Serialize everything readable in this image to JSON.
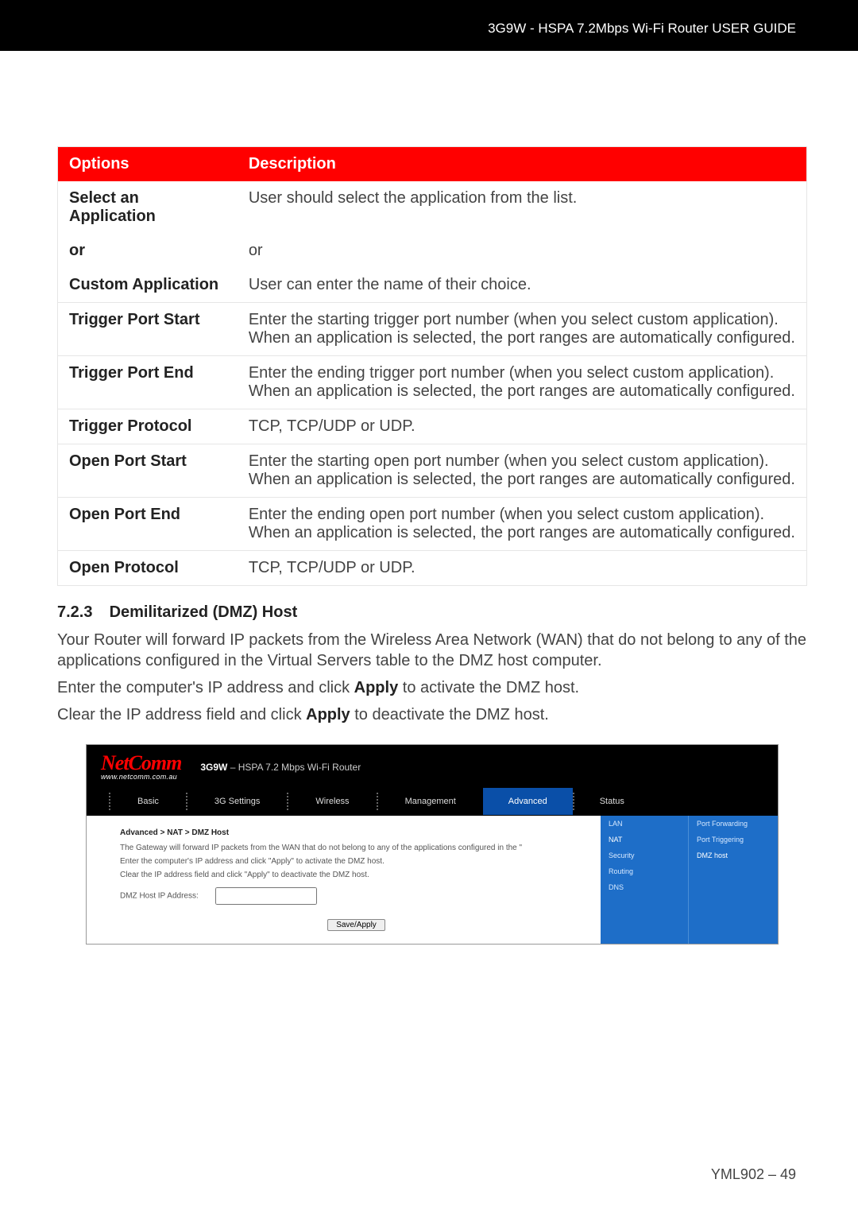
{
  "header": {
    "title": "3G9W - HSPA 7.2Mbps Wi-Fi Router USER GUIDE"
  },
  "table": {
    "head_option": "Options",
    "head_desc": "Description",
    "rows": [
      {
        "label": "Select an Application",
        "desc": "User should select the application from the list.",
        "sep": false
      },
      {
        "label": "or",
        "desc": "or",
        "sep": false
      },
      {
        "label": "Custom Application",
        "desc": "User can enter the name of their choice.",
        "sep": false
      },
      {
        "label": "Trigger Port Start",
        "desc": "Enter the starting trigger port number (when you select custom application).  When an application is selected, the port ranges are automatically configured.",
        "sep": true
      },
      {
        "label": "Trigger Port End",
        "desc": "Enter the ending trigger port number (when you select custom application).  When an application is selected, the port ranges are automatically configured.",
        "sep": true
      },
      {
        "label": "Trigger Protocol",
        "desc": "TCP, TCP/UDP or UDP.",
        "sep": true
      },
      {
        "label": "Open Port Start",
        "desc": "Enter the starting open port number (when you select custom application).  When an application is selected, the port ranges are automatically configured.",
        "sep": true
      },
      {
        "label": "Open Port End",
        "desc": "Enter the ending open port number (when you select custom application).  When an application is selected, the port ranges are automatically configured.",
        "sep": true
      },
      {
        "label": "Open Protocol",
        "desc": "TCP, TCP/UDP or UDP.",
        "sep": true
      }
    ]
  },
  "section": {
    "num": "7.2.3",
    "title": "Demilitarized (DMZ) Host",
    "p1a": "Your Router will forward IP packets from the Wireless Area Network (WAN) that do not belong to any of the applications configured in the Virtual Servers table to the DMZ host computer.",
    "p2_pre": "Enter the computer's IP address and click ",
    "p2_bold": "Apply",
    "p2_post": " to activate the DMZ host.",
    "p3_pre": "Clear the IP address field and click ",
    "p3_bold": "Apply",
    "p3_post": " to deactivate the DMZ host."
  },
  "shot": {
    "logo": "NetComm",
    "logo_sub": "www.netcomm.com.au",
    "title_bold": "3G9W",
    "title_rest": " – HSPA 7.2 Mbps Wi-Fi Router",
    "tabs": [
      "Basic",
      "3G Settings",
      "Wireless",
      "Management",
      "Advanced",
      "Status"
    ],
    "active_tab": "Advanced",
    "breadcrumb": "Advanced > NAT > DMZ Host",
    "line1": "The Gateway will forward IP packets from the WAN that do not belong to any of the applications configured in the \"",
    "line2": "Enter the computer's IP address and click \"Apply\" to activate the DMZ host.",
    "line3": "Clear the IP address field and click \"Apply\" to deactivate the DMZ host.",
    "ip_label": "DMZ Host IP Address:",
    "ip_value": "",
    "button": "Save/Apply",
    "side": [
      "LAN",
      "NAT",
      "Security",
      "Routing",
      "DNS"
    ],
    "side_sel": "NAT",
    "sub": [
      "Port Forwarding",
      "Port Triggering",
      "DMZ host"
    ],
    "sub_sel": "DMZ host"
  },
  "footer": {
    "text": "YML902 – 49"
  }
}
